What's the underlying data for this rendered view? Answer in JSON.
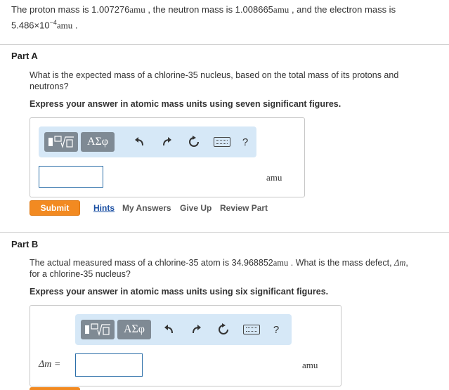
{
  "intro": {
    "proton_label": "The proton mass is 1.007276",
    "unit_amu": "amu",
    "neutron_label": ", the neutron mass is 1.008665",
    "electron_label": ", and the electron mass is",
    "electron_value": "5.486×10",
    "electron_exp": "−4",
    "period": "."
  },
  "partA": {
    "title": "Part A",
    "question": "What is the expected mass of a chlorine-35 nucleus, based on the total mass of its protons and neutrons?",
    "instruction": "Express your answer in atomic mass units using seven significant figures.",
    "unit": "amu",
    "input_value": "",
    "toolbar": {
      "greek_label": "ΑΣφ",
      "help_label": "?"
    },
    "actions": {
      "submit": "Submit",
      "hints": "Hints",
      "my_answers": "My Answers",
      "give_up": "Give Up",
      "review_part": "Review Part"
    }
  },
  "partB": {
    "title": "Part B",
    "question_start": "The actual measured mass of a chlorine-35 atom is 34.968852",
    "question_unit": "amu",
    "question_mid": ". What is the mass defect, ",
    "delta_m": "Δm",
    "question_end": ",",
    "question_line2": "for a chlorine-35 nucleus?",
    "instruction": "Express your answer in atomic mass units using six significant figures.",
    "input_label": "Δm =",
    "unit": "amu",
    "input_value": "",
    "toolbar": {
      "greek_label": "ΑΣφ",
      "help_label": "?"
    }
  }
}
